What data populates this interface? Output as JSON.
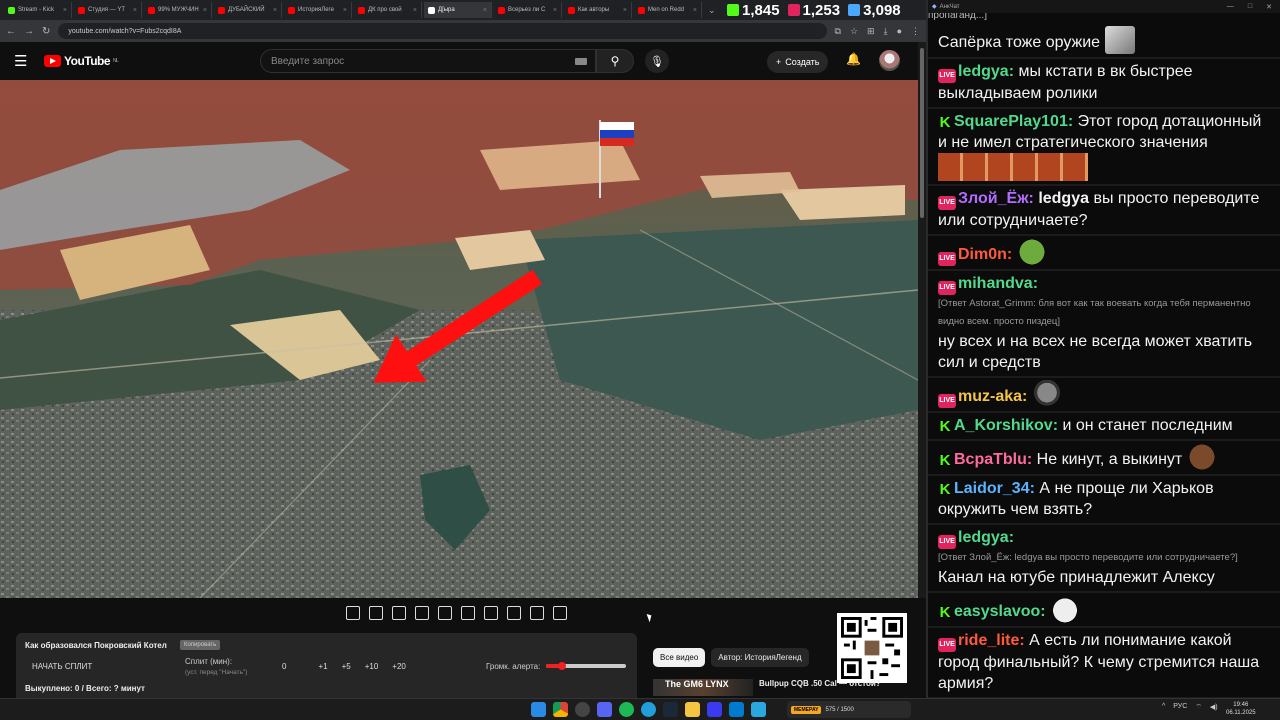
{
  "browser": {
    "tabs": [
      {
        "label": "Stream - Kick",
        "color": "#53fc18"
      },
      {
        "label": "Студия — YT",
        "color": "#ff0000"
      },
      {
        "label": "99% МУЖЧИН",
        "color": "#ff0000"
      },
      {
        "label": "ДУБАЙСКИЙ",
        "color": "#ff0000"
      },
      {
        "label": "ИсторияЛеге",
        "color": "#ff0000"
      },
      {
        "label": "ДК про свой",
        "color": "#ff0000"
      },
      {
        "label": "Д[ыра",
        "color": "#ffffff"
      },
      {
        "label": "Всерьез ли С",
        "color": "#ff0000"
      },
      {
        "label": "Как авторы",
        "color": "#ff0000"
      },
      {
        "label": "Men on Redd",
        "color": "#ff0000"
      }
    ],
    "url": "youtube.com/watch?v=Fubs2cqdI8A"
  },
  "counters": [
    {
      "icon": "kick-icon",
      "value": "1,845",
      "color": "#53fc18"
    },
    {
      "icon": "vk-live-icon",
      "value": "1,253",
      "color": "#e0245e"
    },
    {
      "icon": "viewers-icon",
      "value": "3,098",
      "color": "#4aa8ff"
    }
  ],
  "youtube": {
    "logo_text": "YouTube",
    "region": "NL",
    "search_placeholder": "Введите запрос",
    "create_label": "Создать"
  },
  "split_overlay": {
    "title": "Как образовался Покровский Котел",
    "copy_label": "Копировать",
    "start_label": "НАЧАТЬ СПЛИТ",
    "split_label": "Сплит (мин):",
    "split_hint": "(уст. перед \"Начать\")",
    "split_value": "0",
    "steps": [
      "+1",
      "+5",
      "+10",
      "+20"
    ],
    "volume_label": "Громк. алерта:",
    "volume_level": 0.2,
    "bought_line": "Выкуплено: 0 / Всего: ? минут"
  },
  "related": {
    "chips": [
      "Все видео",
      "Автор: ИсторияЛегенд"
    ],
    "next_video_thumb": "The GM6 LYNX",
    "next_video_title": "Bullpup CQB .50 Cal — отстой?"
  },
  "chat": {
    "title": "АнкЧат",
    "top_cutoff": "пропаганд...]",
    "messages": [
      {
        "platform": "none",
        "user": "",
        "user_color": "#ffffff",
        "text": "Сапёрка тоже оружие",
        "emote": "sapper-emote"
      },
      {
        "platform": "vk",
        "user": "ledgya:",
        "user_color": "#53d98c",
        "text": "мы кстати в вк быстрее выкладываем ролики"
      },
      {
        "platform": "kick",
        "user": "SquarePlay101:",
        "user_color": "#53d98c",
        "text": "Этот город дотационный и не имел стратегического значения",
        "emote": "face-row-emote"
      },
      {
        "platform": "vk",
        "user": "Злой_Ёж:",
        "user_color": "#b46cff",
        "text": "ledgya вы просто переводите или сотрудничаете?",
        "bold_prefix": "ledgya"
      },
      {
        "platform": "vk",
        "user": "Dim0n:",
        "user_color": "#ff5a3c",
        "text": "",
        "emote": "pepe-emote"
      },
      {
        "platform": "vk",
        "user": "mihandva:",
        "user_color": "#53d98c",
        "reply": "[Ответ Astorat_Grimm: бля вот как так воевать когда тебя перманентно видно всем. просто пиздец]",
        "text": "ну всех и на всех не всегда может хватить сил и средств"
      },
      {
        "platform": "vk",
        "user": "muz-aka:",
        "user_color": "#f5c542",
        "text": "",
        "emote": "mask-emote"
      },
      {
        "platform": "kick",
        "user": "A_Korshikov:",
        "user_color": "#53d98c",
        "text": "и он станет последним"
      },
      {
        "platform": "kick",
        "user": "BcpaTblu:",
        "user_color": "#ff6b9a",
        "text": "Не кинут, а выкинут",
        "emote": "laugh-emote"
      },
      {
        "platform": "kick",
        "user": "Laidor_34:",
        "user_color": "#5ab4ff",
        "text": "А не проще ли Харьков окружить чем взять?"
      },
      {
        "platform": "vk",
        "user": "ledgya:",
        "user_color": "#53d98c",
        "reply": "[Ответ Злой_Ёж: ledgya вы просто переводите или сотрудничаете?]",
        "text": "Канал на ютубе принадлежит Алексу"
      },
      {
        "platform": "kick",
        "user": "easyslavoo:",
        "user_color": "#53d98c",
        "text": "",
        "emote": "cat-emote"
      },
      {
        "platform": "vk",
        "user": "ride_lite:",
        "user_color": "#ff5a3c",
        "text": "А есть ли понимание какой город финальный? К чему стремится наша армия?"
      }
    ]
  },
  "taskbar": {
    "widget_name": "MEMEPAY",
    "widget_value": "575 / 1500",
    "lang": "РУС",
    "time": "19:46",
    "date": "06.11.2025"
  }
}
